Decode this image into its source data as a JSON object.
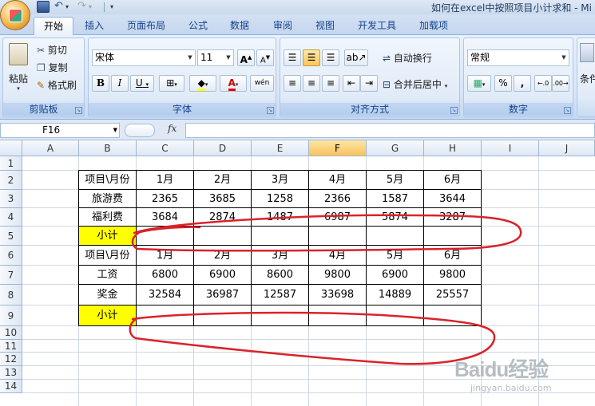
{
  "window": {
    "title": "如何在excel中按照项目小计求和 - Mi"
  },
  "tabs": [
    "开始",
    "插入",
    "页面布局",
    "公式",
    "数据",
    "审阅",
    "视图",
    "开发工具",
    "加载项"
  ],
  "active_tab": "开始",
  "ribbon": {
    "clipboard": {
      "label": "剪贴板",
      "paste": "粘贴",
      "cut": "剪切",
      "copy": "复制",
      "format_painter": "格式刷"
    },
    "font": {
      "label": "字体",
      "font_name": "宋体",
      "font_size": "11",
      "bold": "B",
      "italic": "I",
      "underline": "U",
      "grow": "A",
      "shrink": "A"
    },
    "alignment": {
      "label": "对齐方式",
      "wrap": "自动换行",
      "merge": "合并后居中"
    },
    "number": {
      "label": "数字",
      "format": "常规",
      "percent": "%",
      "comma": ","
    },
    "cells": {
      "label": "条件"
    }
  },
  "formula_bar": {
    "name_box": "F16",
    "fx": "fx",
    "formula": ""
  },
  "columns": [
    "A",
    "B",
    "C",
    "D",
    "E",
    "F",
    "G",
    "H",
    "I",
    "J"
  ],
  "selected_column": "F",
  "rows": [
    "1",
    "2",
    "3",
    "4",
    "5",
    "6",
    "7",
    "8",
    "9",
    "10",
    "11",
    "12",
    "13",
    "14"
  ],
  "table": [
    [
      "项目\\月份",
      "1月",
      "2月",
      "3月",
      "4月",
      "5月",
      "6月"
    ],
    [
      "旅游费",
      "2365",
      "3685",
      "1258",
      "2366",
      "1587",
      "3644"
    ],
    [
      "福利费",
      "3684",
      "2874",
      "1487",
      "6987",
      "5874",
      "3287"
    ],
    [
      "小计",
      "",
      "",
      "",
      "",
      "",
      ""
    ],
    [
      "项目\\月份",
      "1月",
      "2月",
      "3月",
      "4月",
      "5月",
      "6月"
    ],
    [
      "工资",
      "6800",
      "6900",
      "8600",
      "9800",
      "6900",
      "9800"
    ],
    [
      "奖金",
      "32584",
      "36987",
      "12587",
      "33698",
      "14889",
      "25557"
    ],
    [
      "小计",
      "",
      "",
      "",
      "",
      "",
      ""
    ]
  ],
  "highlight_color": "#ffff00",
  "annotation_color": "#d9232a",
  "watermark": {
    "brand": "Baidu经验",
    "url": "jingyan.baidu.com"
  }
}
